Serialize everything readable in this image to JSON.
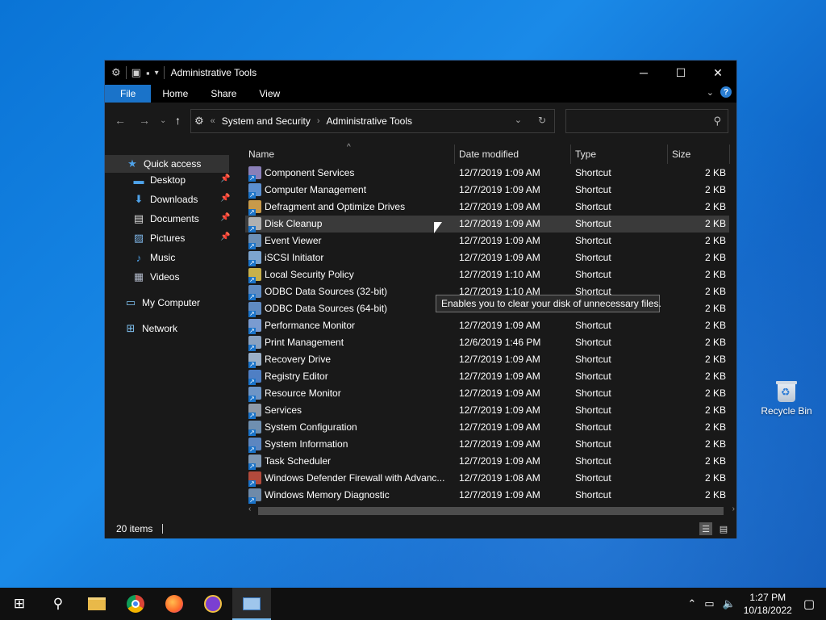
{
  "window": {
    "title": "Administrative Tools",
    "controls": {
      "minimize": "─",
      "maximize": "☐",
      "close": "✕"
    }
  },
  "ribbon": {
    "tabs": [
      "File",
      "Home",
      "Share",
      "View"
    ]
  },
  "address": {
    "overflow": "«",
    "crumbs": [
      "System and Security",
      "Administrative Tools"
    ]
  },
  "search": {
    "placeholder": ""
  },
  "nav": {
    "quick_access": "Quick access",
    "items": [
      {
        "label": "Desktop",
        "icon": "desktop-icon",
        "pinned": true
      },
      {
        "label": "Downloads",
        "icon": "downloads-icon",
        "pinned": true
      },
      {
        "label": "Documents",
        "icon": "documents-icon",
        "pinned": true
      },
      {
        "label": "Pictures",
        "icon": "pictures-icon",
        "pinned": true
      },
      {
        "label": "Music",
        "icon": "music-icon",
        "pinned": false
      },
      {
        "label": "Videos",
        "icon": "videos-icon",
        "pinned": false
      }
    ],
    "my_computer": "My Computer",
    "network": "Network"
  },
  "columns": {
    "name": "Name",
    "date": "Date modified",
    "type": "Type",
    "size": "Size"
  },
  "files": [
    {
      "name": "Component Services",
      "date": "12/7/2019 1:09 AM",
      "type": "Shortcut",
      "size": "2 KB",
      "color": "#8a7fb8"
    },
    {
      "name": "Computer Management",
      "date": "12/7/2019 1:09 AM",
      "type": "Shortcut",
      "size": "2 KB",
      "color": "#5b8fd0"
    },
    {
      "name": "Defragment and Optimize Drives",
      "date": "12/7/2019 1:09 AM",
      "type": "Shortcut",
      "size": "2 KB",
      "color": "#c79a4a"
    },
    {
      "name": "Disk Cleanup",
      "date": "12/7/2019 1:09 AM",
      "type": "Shortcut",
      "size": "2 KB",
      "color": "#b0b0b0"
    },
    {
      "name": "Event Viewer",
      "date": "12/7/2019 1:09 AM",
      "type": "Shortcut",
      "size": "2 KB",
      "color": "#6c8fb5"
    },
    {
      "name": "iSCSI Initiator",
      "date": "12/7/2019 1:09 AM",
      "type": "Shortcut",
      "size": "2 KB",
      "color": "#7ca4cf"
    },
    {
      "name": "Local Security Policy",
      "date": "12/7/2019 1:10 AM",
      "type": "Shortcut",
      "size": "2 KB",
      "color": "#c8b14a"
    },
    {
      "name": "ODBC Data Sources (32-bit)",
      "date": "12/7/2019 1:10 AM",
      "type": "Shortcut",
      "size": "2 KB",
      "color": "#5f8bc2"
    },
    {
      "name": "ODBC Data Sources (64-bit)",
      "date": "12/7/2019 1:09 AM",
      "type": "Shortcut",
      "size": "2 KB",
      "color": "#5f8bc2"
    },
    {
      "name": "Performance Monitor",
      "date": "12/7/2019 1:09 AM",
      "type": "Shortcut",
      "size": "2 KB",
      "color": "#7a9bd0"
    },
    {
      "name": "Print Management",
      "date": "12/6/2019 1:46 PM",
      "type": "Shortcut",
      "size": "2 KB",
      "color": "#8aa2c0"
    },
    {
      "name": "Recovery Drive",
      "date": "12/7/2019 1:09 AM",
      "type": "Shortcut",
      "size": "2 KB",
      "color": "#9bb0c8"
    },
    {
      "name": "Registry Editor",
      "date": "12/7/2019 1:09 AM",
      "type": "Shortcut",
      "size": "2 KB",
      "color": "#4f7fc4"
    },
    {
      "name": "Resource Monitor",
      "date": "12/7/2019 1:09 AM",
      "type": "Shortcut",
      "size": "2 KB",
      "color": "#6d95c6"
    },
    {
      "name": "Services",
      "date": "12/7/2019 1:09 AM",
      "type": "Shortcut",
      "size": "2 KB",
      "color": "#8f99a6"
    },
    {
      "name": "System Configuration",
      "date": "12/7/2019 1:09 AM",
      "type": "Shortcut",
      "size": "2 KB",
      "color": "#6f8fb0"
    },
    {
      "name": "System Information",
      "date": "12/7/2019 1:09 AM",
      "type": "Shortcut",
      "size": "2 KB",
      "color": "#5c86c0"
    },
    {
      "name": "Task Scheduler",
      "date": "12/7/2019 1:09 AM",
      "type": "Shortcut",
      "size": "2 KB",
      "color": "#7e97b3"
    },
    {
      "name": "Windows Defender Firewall with Advanc...",
      "date": "12/7/2019 1:08 AM",
      "type": "Shortcut",
      "size": "2 KB",
      "color": "#b24a3c"
    },
    {
      "name": "Windows Memory Diagnostic",
      "date": "12/7/2019 1:09 AM",
      "type": "Shortcut",
      "size": "2 KB",
      "color": "#6f8aa8"
    }
  ],
  "tooltip": "Enables you to clear your disk of unnecessary files.",
  "status": {
    "items": "20 items"
  },
  "desktop": {
    "recycle_bin": "Recycle Bin"
  },
  "taskbar": {
    "clock_time": "1:27 PM",
    "clock_date": "10/18/2022"
  }
}
